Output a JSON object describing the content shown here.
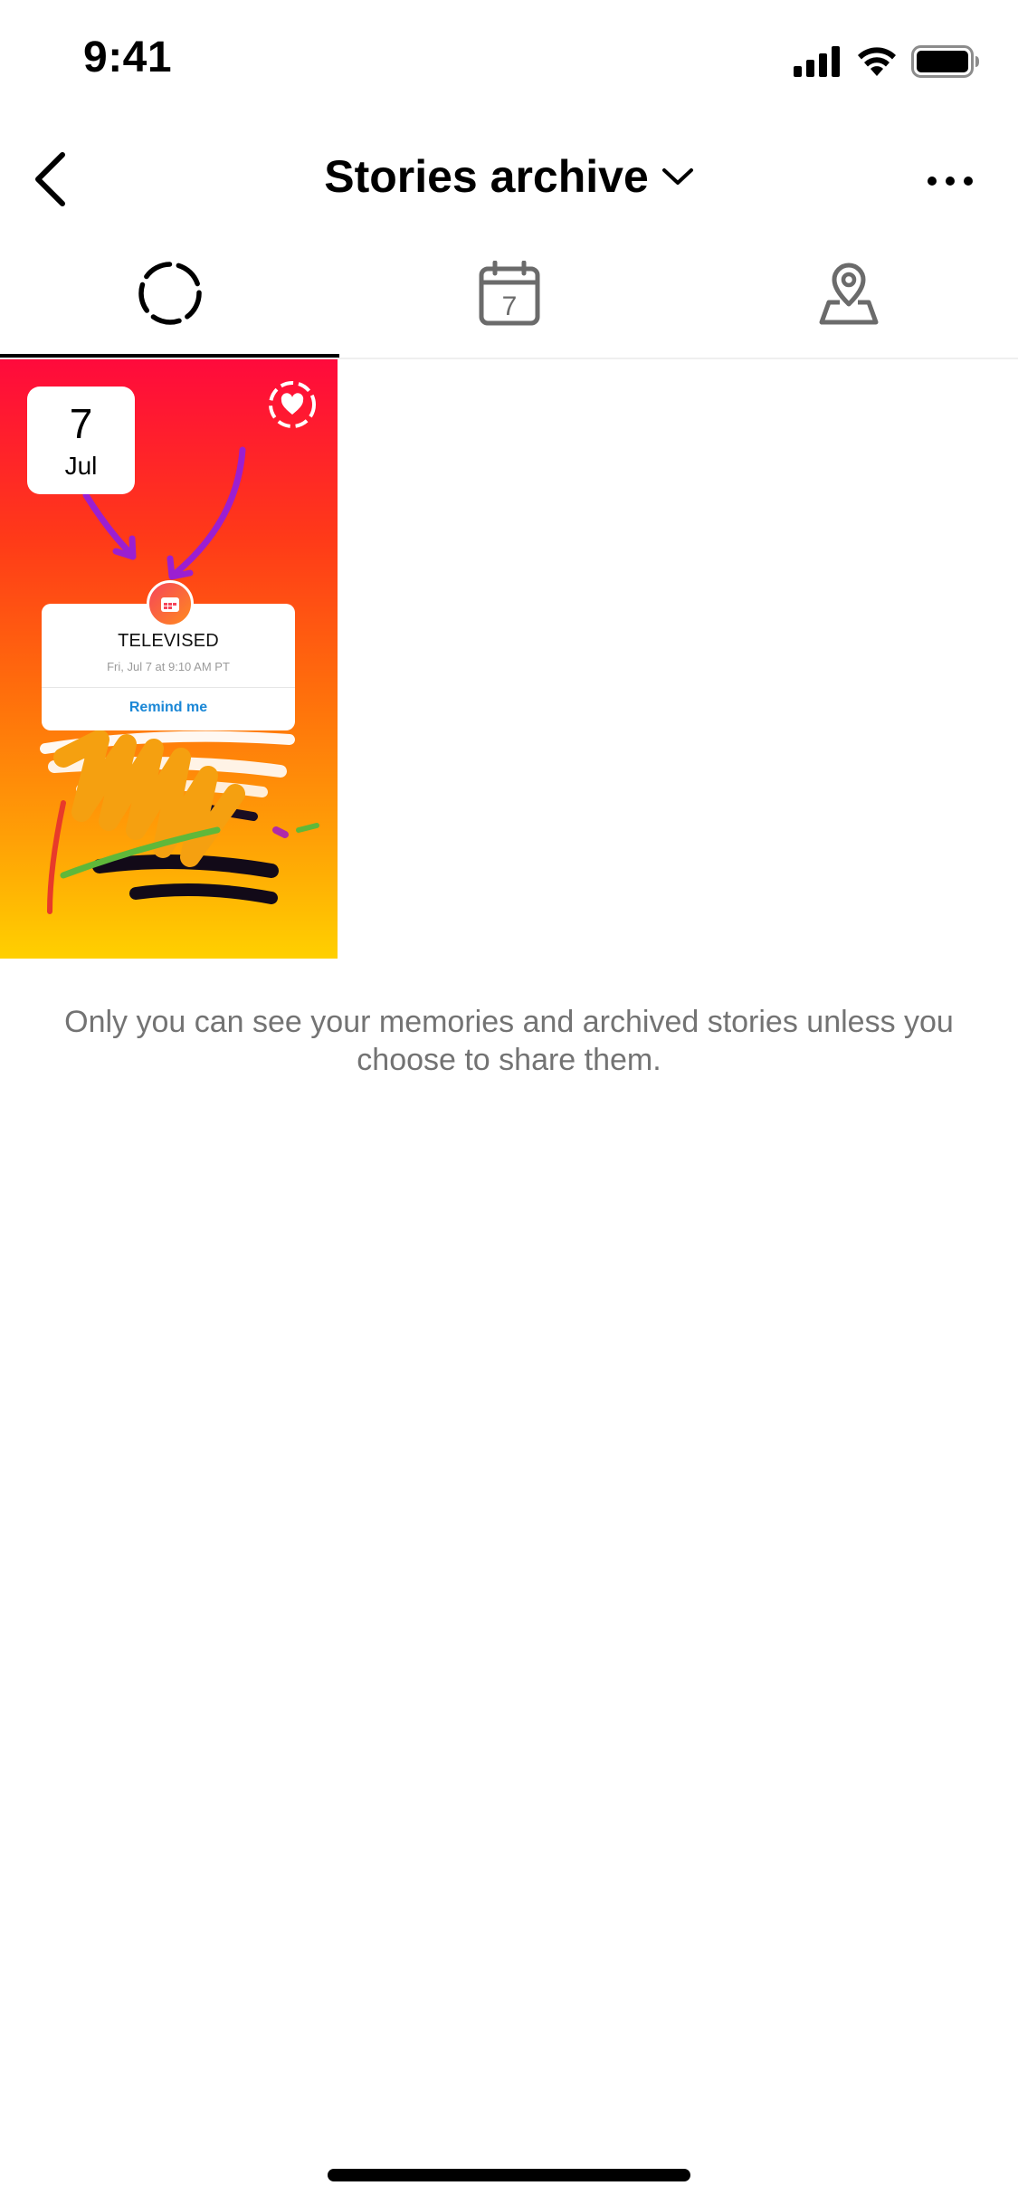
{
  "status_bar": {
    "time": "9:41",
    "icons": [
      "signal-icon",
      "wifi-icon",
      "battery-icon"
    ]
  },
  "nav": {
    "title": "Stories archive",
    "back_icon": "chevron-left-icon",
    "dropdown_icon": "chevron-down-icon",
    "more_icon": "more-horizontal-icon"
  },
  "tabs": [
    {
      "id": "stories",
      "icon": "stories-circle-icon",
      "active": true
    },
    {
      "id": "calendar",
      "icon": "calendar-icon",
      "icon_text": "7",
      "active": false
    },
    {
      "id": "map",
      "icon": "map-pin-icon",
      "active": false
    }
  ],
  "archive_items": [
    {
      "date_day": "7",
      "date_month": "Jul",
      "reminder": {
        "title": "TELEVISED",
        "subtitle": "Fri, Jul 7 at 9:10 AM PT",
        "action": "Remind me"
      }
    }
  ],
  "info_text": "Only you can see your memories and archived stories unless you choose to share them.",
  "colors": {
    "text_secondary": "#737373",
    "link_blue": "#1a87d6",
    "story_gradient_top": "#ff0a3c",
    "story_gradient_bottom": "#ffd000"
  }
}
